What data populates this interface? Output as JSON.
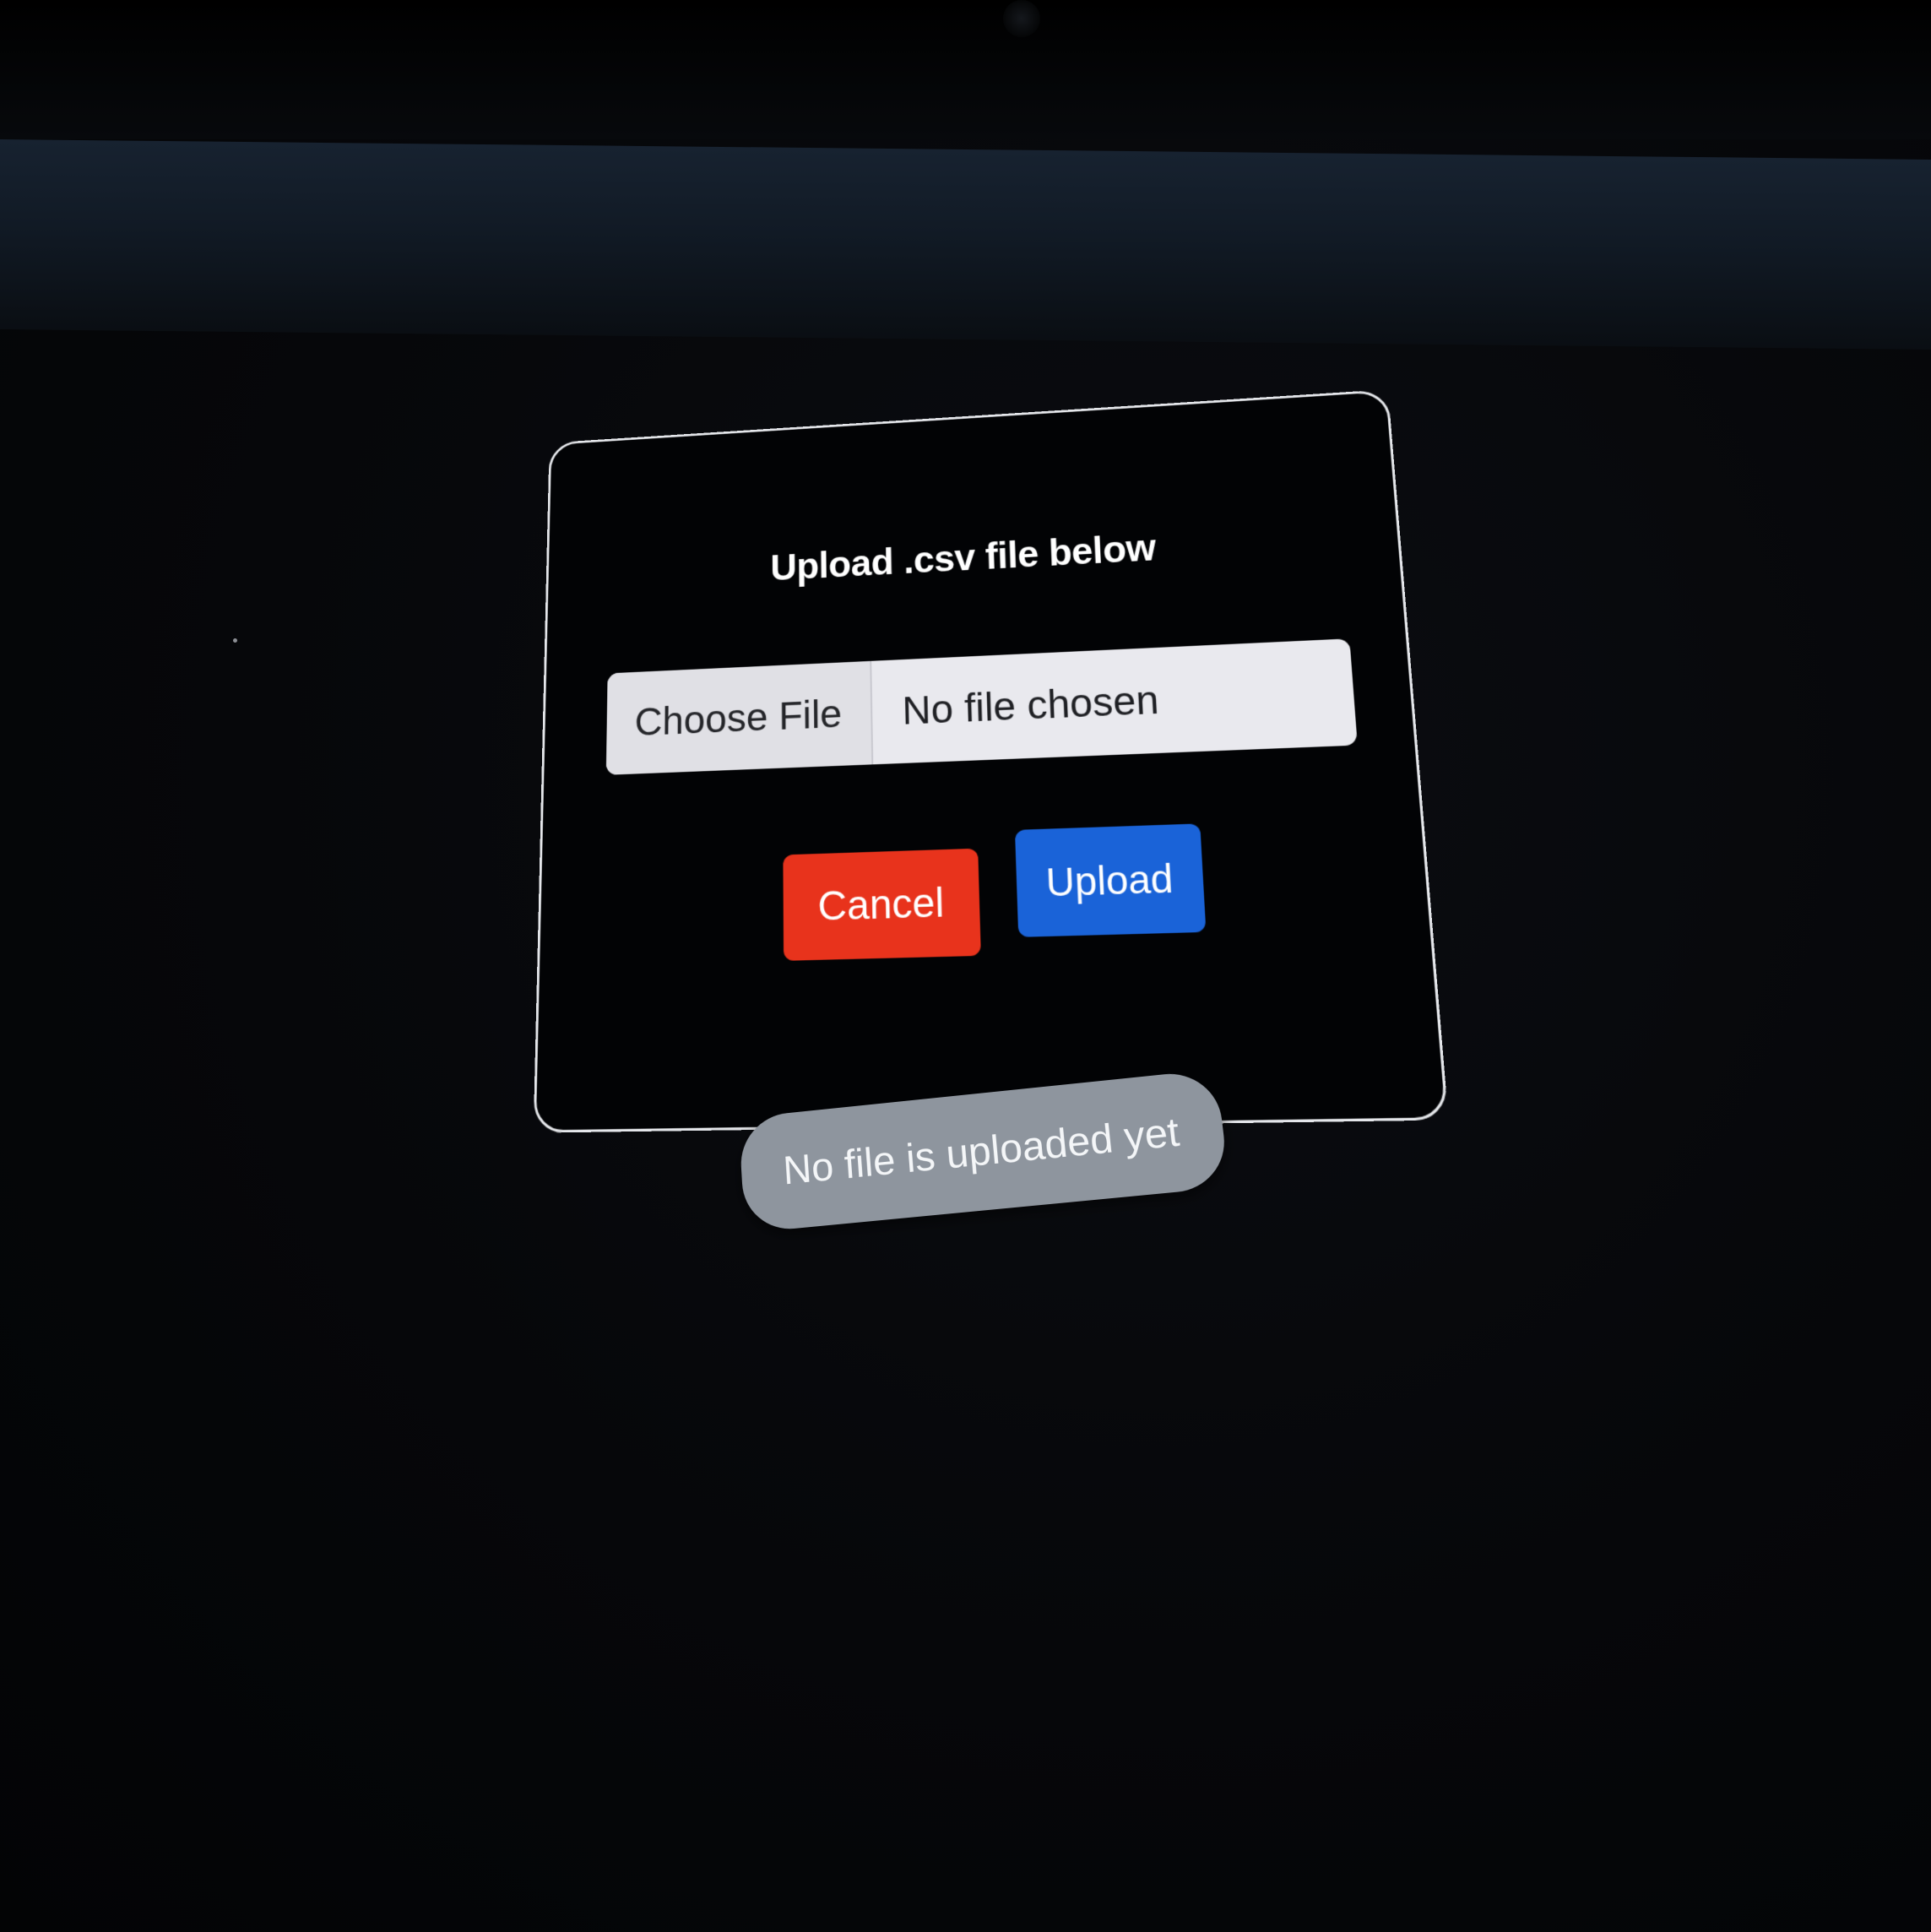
{
  "dialog": {
    "title": "Upload .csv file below",
    "file_input": {
      "button_label": "Choose File",
      "status_text": "No file chosen"
    },
    "cancel_label": "Cancel",
    "upload_label": "Upload"
  },
  "status": {
    "text": "No file is uploaded yet"
  },
  "colors": {
    "cancel": "#e8331c",
    "upload": "#1a63d8",
    "status_pill": "#8e959e",
    "background": "#050608"
  }
}
